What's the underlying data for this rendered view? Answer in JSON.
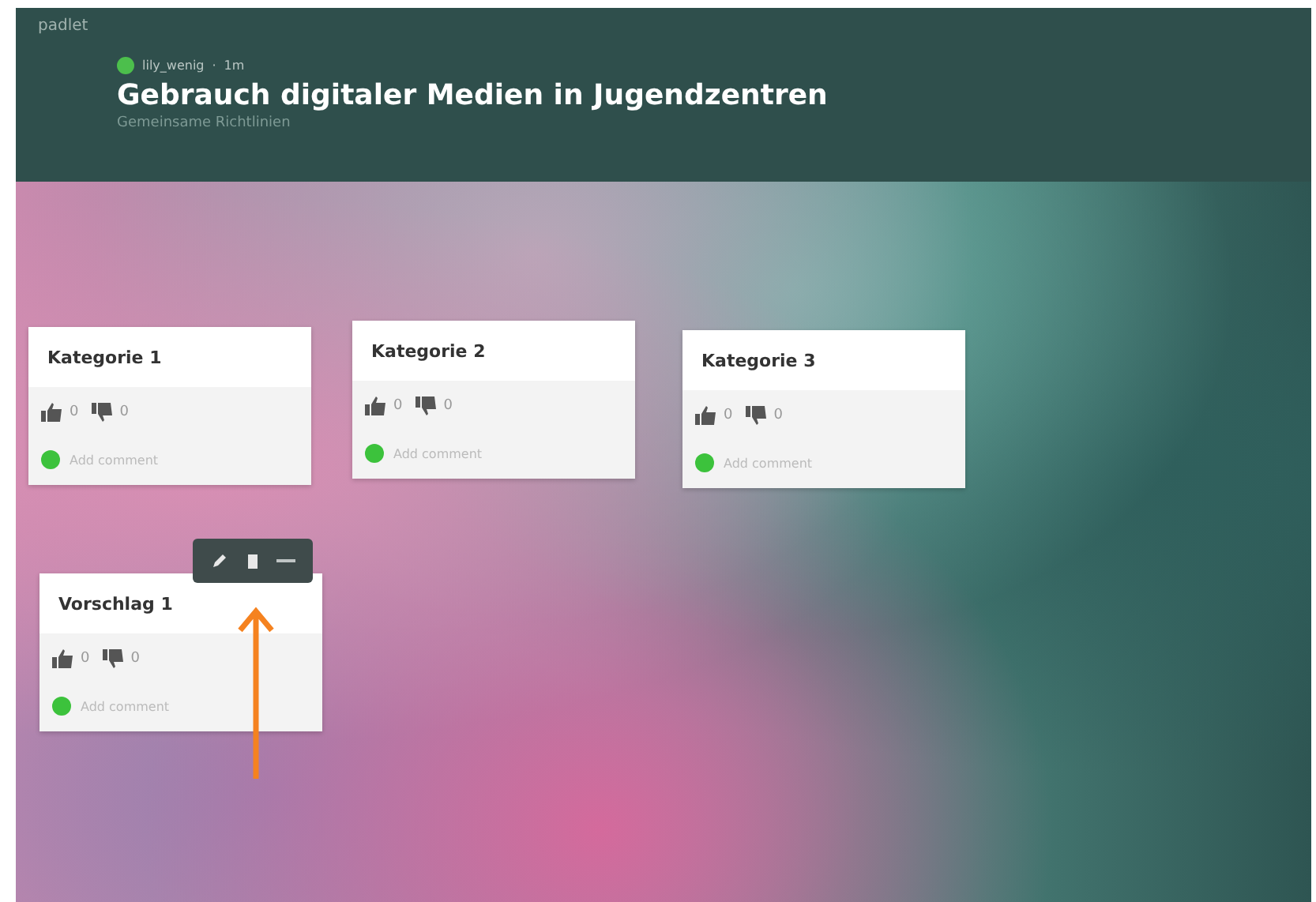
{
  "app": {
    "logo": "padlet"
  },
  "header": {
    "author": "lily_wenig",
    "separator": "·",
    "time": "1m",
    "title": "Gebrauch digitaler Medien in Jugendzentren",
    "subtitle": "Gemeinsame Richtlinien"
  },
  "posts": [
    {
      "title": "Kategorie 1",
      "likes": "0",
      "dislikes": "0",
      "comment_placeholder": "Add comment",
      "toolbar": false
    },
    {
      "title": "Kategorie 2",
      "likes": "0",
      "dislikes": "0",
      "comment_placeholder": "Add comment",
      "toolbar": false
    },
    {
      "title": "Kategorie 3",
      "likes": "0",
      "dislikes": "0",
      "comment_placeholder": "Add comment",
      "toolbar": false
    },
    {
      "title": "Vorschlag 1",
      "likes": "0",
      "dislikes": "0",
      "comment_placeholder": "Add comment",
      "toolbar": true
    }
  ]
}
